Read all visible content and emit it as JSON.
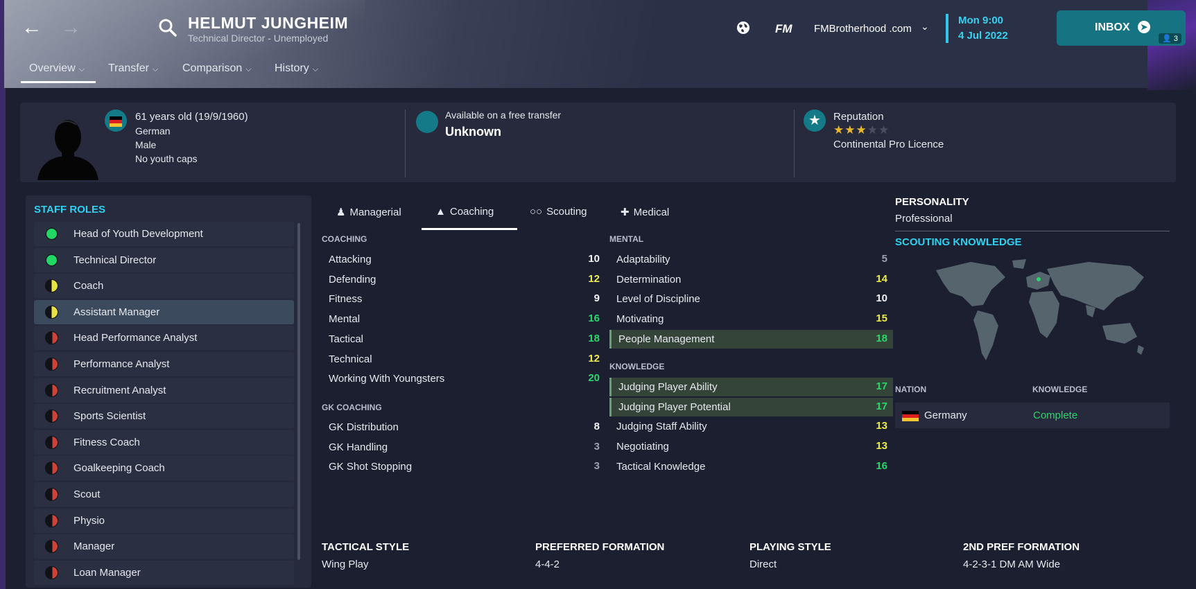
{
  "header": {
    "name": "HELMUT JUNGHEIM",
    "subtitle": "Technical Director - Unemployed",
    "tabs": {
      "overview": "Overview",
      "transfer": "Transfer",
      "comparison": "Comparison",
      "history": "History"
    },
    "logo": "FM",
    "site": "FMBrotherhood .com",
    "date_time": "Mon 9:00",
    "date": "4 Jul 2022",
    "inbox": "INBOX",
    "inbox_count": "3"
  },
  "info": {
    "age": "61 years old (19/9/1960)",
    "nationality": "German",
    "gender": "Male",
    "caps": "No youth caps",
    "transfer_status": "Available on a free transfer",
    "transfer_value": "Unknown",
    "reputation_label": "Reputation",
    "reputation_stars": 3,
    "reputation_max": 5,
    "licence": "Continental Pro Licence"
  },
  "roles": {
    "title": "STAFF ROLES",
    "items": [
      {
        "label": "Head of Youth Development",
        "status": "green"
      },
      {
        "label": "Technical Director",
        "status": "green"
      },
      {
        "label": "Coach",
        "status": "half"
      },
      {
        "label": "Assistant Manager",
        "status": "half",
        "selected": true
      },
      {
        "label": "Head Performance Analyst",
        "status": "red"
      },
      {
        "label": "Performance Analyst",
        "status": "red"
      },
      {
        "label": "Recruitment Analyst",
        "status": "red"
      },
      {
        "label": "Sports Scientist",
        "status": "red"
      },
      {
        "label": "Fitness Coach",
        "status": "red"
      },
      {
        "label": "Goalkeeping Coach",
        "status": "red"
      },
      {
        "label": "Scout",
        "status": "red"
      },
      {
        "label": "Physio",
        "status": "red"
      },
      {
        "label": "Manager",
        "status": "red"
      },
      {
        "label": "Loan Manager",
        "status": "red"
      }
    ]
  },
  "tabs": {
    "managerial": "Managerial",
    "coaching": "Coaching",
    "scouting": "Scouting",
    "medical": "Medical"
  },
  "coaching": {
    "title": "COACHING",
    "items": [
      {
        "label": "Attacking",
        "value": "10",
        "tone": "white"
      },
      {
        "label": "Defending",
        "value": "12",
        "tone": "yellow"
      },
      {
        "label": "Fitness",
        "value": "9",
        "tone": "white"
      },
      {
        "label": "Mental",
        "value": "16",
        "tone": "green"
      },
      {
        "label": "Tactical",
        "value": "18",
        "tone": "green"
      },
      {
        "label": "Technical",
        "value": "12",
        "tone": "yellow"
      },
      {
        "label": "Working With Youngsters",
        "value": "20",
        "tone": "green"
      }
    ]
  },
  "gk": {
    "title": "GK COACHING",
    "items": [
      {
        "label": "GK Distribution",
        "value": "8",
        "tone": "white"
      },
      {
        "label": "GK Handling",
        "value": "3",
        "tone": "grey"
      },
      {
        "label": "GK Shot Stopping",
        "value": "3",
        "tone": "grey"
      }
    ]
  },
  "mental": {
    "title": "MENTAL",
    "items": [
      {
        "label": "Adaptability",
        "value": "5",
        "tone": "grey"
      },
      {
        "label": "Determination",
        "value": "14",
        "tone": "yellow"
      },
      {
        "label": "Level of Discipline",
        "value": "10",
        "tone": "white"
      },
      {
        "label": "Motivating",
        "value": "15",
        "tone": "yellow"
      },
      {
        "label": "People Management",
        "value": "18",
        "tone": "green",
        "highlight": true
      }
    ]
  },
  "knowledge": {
    "title": "KNOWLEDGE",
    "items": [
      {
        "label": "Judging Player Ability",
        "value": "17",
        "tone": "green",
        "highlight": true
      },
      {
        "label": "Judging Player Potential",
        "value": "17",
        "tone": "green",
        "highlight": true
      },
      {
        "label": "Judging Staff Ability",
        "value": "13",
        "tone": "yellow"
      },
      {
        "label": "Negotiating",
        "value": "13",
        "tone": "yellow"
      },
      {
        "label": "Tactical Knowledge",
        "value": "16",
        "tone": "green"
      }
    ]
  },
  "personality": {
    "title": "PERSONALITY",
    "value": "Professional"
  },
  "scouting": {
    "title": "SCOUTING KNOWLEDGE",
    "col_nation": "NATION",
    "col_knowledge": "KNOWLEDGE",
    "nation": "Germany",
    "knowledge": "Complete"
  },
  "style": {
    "tactical_label": "TACTICAL STYLE",
    "tactical": "Wing Play",
    "formation_label": "PREFERRED FORMATION",
    "formation": "4-4-2",
    "playing_label": "PLAYING STYLE",
    "playing": "Direct",
    "formation2_label": "2ND PREF FORMATION",
    "formation2": "4-2-3-1 DM AM Wide"
  },
  "colors": {
    "accent": "#2fd0f0",
    "inbox": "#167482",
    "green": "#28d86a",
    "yellow": "#eded4a"
  }
}
